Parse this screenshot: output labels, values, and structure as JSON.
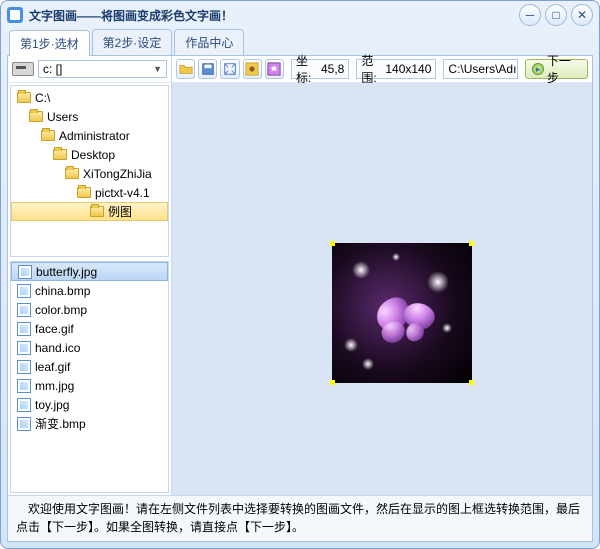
{
  "window": {
    "title": "文字图画——将图画变成彩色文字画！"
  },
  "tabs": [
    {
      "label": "第1步·选材",
      "active": true
    },
    {
      "label": "第2步·设定",
      "active": false
    },
    {
      "label": "作品中心",
      "active": false
    }
  ],
  "drive": {
    "selected": "c: []"
  },
  "tree": [
    {
      "label": "C:\\",
      "indent": 0,
      "open": true
    },
    {
      "label": "Users",
      "indent": 1,
      "open": true
    },
    {
      "label": "Administrator",
      "indent": 2,
      "open": true
    },
    {
      "label": "Desktop",
      "indent": 3,
      "open": true
    },
    {
      "label": "XiTongZhiJia",
      "indent": 4,
      "open": true
    },
    {
      "label": "pictxt-v4.1",
      "indent": 5,
      "open": true
    },
    {
      "label": "例图",
      "indent": 6,
      "open": true,
      "selected": true
    }
  ],
  "files": [
    {
      "name": "butterfly.jpg",
      "selected": true
    },
    {
      "name": "china.bmp"
    },
    {
      "name": "color.bmp"
    },
    {
      "name": "face.gif"
    },
    {
      "name": "hand.ico"
    },
    {
      "name": "leaf.gif"
    },
    {
      "name": "mm.jpg"
    },
    {
      "name": "toy.jpg"
    },
    {
      "name": "渐变.bmp"
    }
  ],
  "toolbar": {
    "coord_label": "坐标:",
    "coord_value": "45,8",
    "range_label": "范围:",
    "range_value": "140x140",
    "path": "C:\\Users\\Adı",
    "next": "下一步"
  },
  "status": "　欢迎使用文字图画！请在左侧文件列表中选择要转换的图画文件，然后在显示的图上框选转换范围，最后点击【下一步】。如果全图转换，请直接点【下一步】。"
}
